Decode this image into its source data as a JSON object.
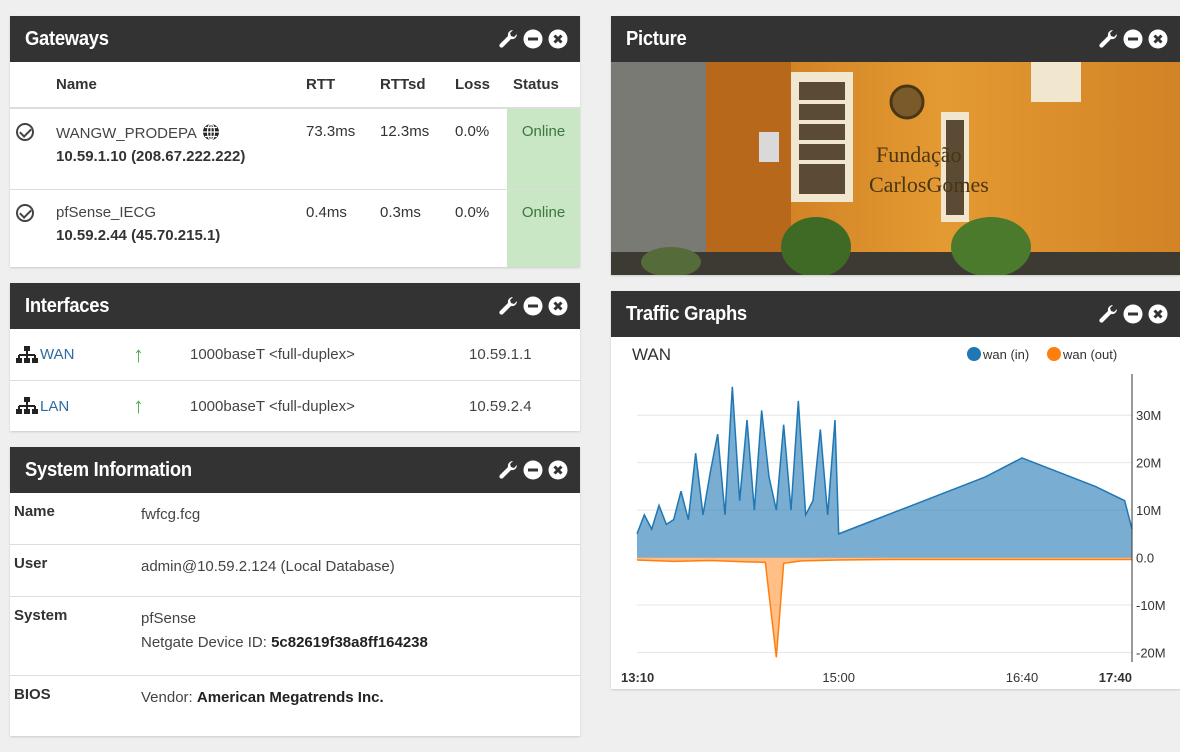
{
  "gateways": {
    "title": "Gateways",
    "columns": [
      "Name",
      "RTT",
      "RTTsd",
      "Loss",
      "Status"
    ],
    "rows": [
      {
        "name": "WANGW_PRODEPA",
        "address": "10.59.1.10 (208.67.222.222)",
        "rtt": "73.3ms",
        "rttsd": "12.3ms",
        "loss": "0.0%",
        "status": "Online"
      },
      {
        "name": "pfSense_IECG",
        "address": "10.59.2.44 (45.70.215.1)",
        "rtt": "0.4ms",
        "rttsd": "0.3ms",
        "loss": "0.0%",
        "status": "Online"
      }
    ]
  },
  "interfaces": {
    "title": "Interfaces",
    "rows": [
      {
        "name": "WAN",
        "media": "1000baseT <full-duplex>",
        "ip": "10.59.1.1"
      },
      {
        "name": "LAN",
        "media": "1000baseT <full-duplex>",
        "ip": "10.59.2.4"
      }
    ]
  },
  "system": {
    "title": "System Information",
    "name_label": "Name",
    "name_value": "fwfcg.fcg",
    "user_label": "User",
    "user_value": "admin@10.59.2.124 (Local Database)",
    "system_label": "System",
    "system_value": "pfSense",
    "device_id_label": "Netgate Device ID: ",
    "device_id_value": "5c82619f38a8ff164238",
    "bios_label": "BIOS",
    "bios_vendor_label": "Vendor: ",
    "bios_vendor_value": "American Megatrends Inc."
  },
  "picture": {
    "title": "Picture",
    "sign_line1": "Fundação",
    "sign_line2": "CarlosGomes"
  },
  "traffic": {
    "title": "Traffic Graphs"
  },
  "colors": {
    "header_bg": "#333333",
    "online_bg": "#c9e7c5",
    "link_blue": "#2d6ca2",
    "up_green": "#4cae4c",
    "wan_in": "#1f77b4",
    "wan_out": "#ff7f0e"
  },
  "chart_data": {
    "type": "area",
    "title": "WAN",
    "series": [
      {
        "name": "wan (in)",
        "color": "#1f77b4",
        "x": [
          "13:10",
          "13:14",
          "13:18",
          "13:22",
          "13:26",
          "13:30",
          "13:34",
          "13:38",
          "13:42",
          "13:46",
          "13:50",
          "13:54",
          "13:58",
          "14:02",
          "14:06",
          "14:10",
          "14:14",
          "14:18",
          "14:22",
          "14:26",
          "14:30",
          "14:34",
          "14:38",
          "14:42",
          "14:46",
          "14:50",
          "14:54",
          "14:58",
          "15:00",
          "15:20",
          "15:40",
          "16:00",
          "16:20",
          "16:40",
          "17:00",
          "17:20",
          "17:36",
          "17:40"
        ],
        "values": [
          5,
          9,
          6,
          11,
          7,
          8,
          14,
          8,
          22,
          9,
          18,
          26,
          9,
          36,
          12,
          29,
          10,
          31,
          17,
          10,
          28,
          10,
          33,
          9,
          12,
          27,
          9,
          29,
          5,
          8,
          11,
          14,
          17,
          21,
          18,
          15,
          12,
          6
        ]
      },
      {
        "name": "wan (out)",
        "color": "#ff7f0e",
        "x": [
          "13:10",
          "13:30",
          "13:50",
          "14:10",
          "14:20",
          "14:26",
          "14:30",
          "14:40",
          "15:00",
          "15:30",
          "16:00",
          "16:40",
          "17:20",
          "17:40"
        ],
        "values": [
          -0.5,
          -0.8,
          -0.6,
          -0.9,
          -1.0,
          -21,
          -1.2,
          -0.7,
          -0.5,
          -0.4,
          -0.4,
          -0.4,
          -0.4,
          -0.4
        ]
      }
    ],
    "x_ticks": [
      "13:10",
      "15:00",
      "16:40",
      "17:40"
    ],
    "y_ticks": [
      "30M",
      "20M",
      "10M",
      "0.0",
      "-10M",
      "-20M"
    ],
    "ylim": [
      -22,
      37
    ],
    "grid": true,
    "legend": "top-right"
  }
}
